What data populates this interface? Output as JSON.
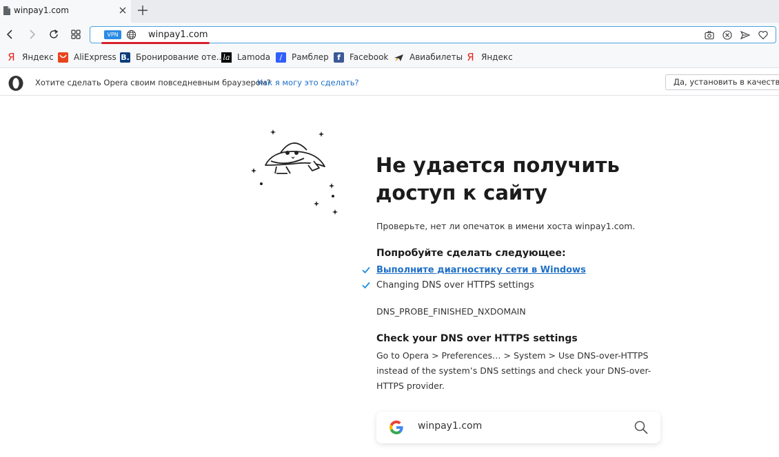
{
  "tab": {
    "title": "winpay1.com"
  },
  "address_bar": {
    "vpn_label": "VPN",
    "url": "winpay1.com"
  },
  "bookmarks": [
    {
      "label": "Яндекс",
      "icon": "yandex-icon"
    },
    {
      "label": "AliExpress",
      "icon": "aliexpress-icon"
    },
    {
      "label": "Бронирование оте...",
      "icon": "booking-icon"
    },
    {
      "label": "Lamoda",
      "icon": "lamoda-icon"
    },
    {
      "label": "Рамблер",
      "icon": "rambler-icon"
    },
    {
      "label": "Facebook",
      "icon": "facebook-icon"
    },
    {
      "label": "Авиабилеты",
      "icon": "plane-icon"
    },
    {
      "label": "Яндекс",
      "icon": "yandex-icon"
    }
  ],
  "infobar": {
    "text": "Хотите сделать Opera своим повседневным браузером?",
    "link": "Как я могу это сделать?",
    "button": "Да, установить в качестве б"
  },
  "error": {
    "heading": "Не удается получить доступ к сайту",
    "check_host": "Проверьте, нет ли опечаток в имени хоста winpay1.com.",
    "try_title": "Попробуйте сделать следующее:",
    "suggestions": [
      "Выполните диагностику сети в Windows",
      "Changing DNS over HTTPS settings"
    ],
    "code": "DNS_PROBE_FINISHED_NXDOMAIN",
    "dns_title": "Check your DNS over HTTPS settings",
    "dns_body": "Go to Opera > Preferences… > System > Use DNS-over-HTTPS instead of the system’s DNS settings and check your DNS-over-HTTPS provider."
  },
  "search_box": {
    "query": "winpay1.com"
  },
  "colors": {
    "accent": "#1e6fc7",
    "url_border": "#4aa3df",
    "underline_mark": "#d6202b",
    "vpn_badge": "#2a8be5"
  }
}
